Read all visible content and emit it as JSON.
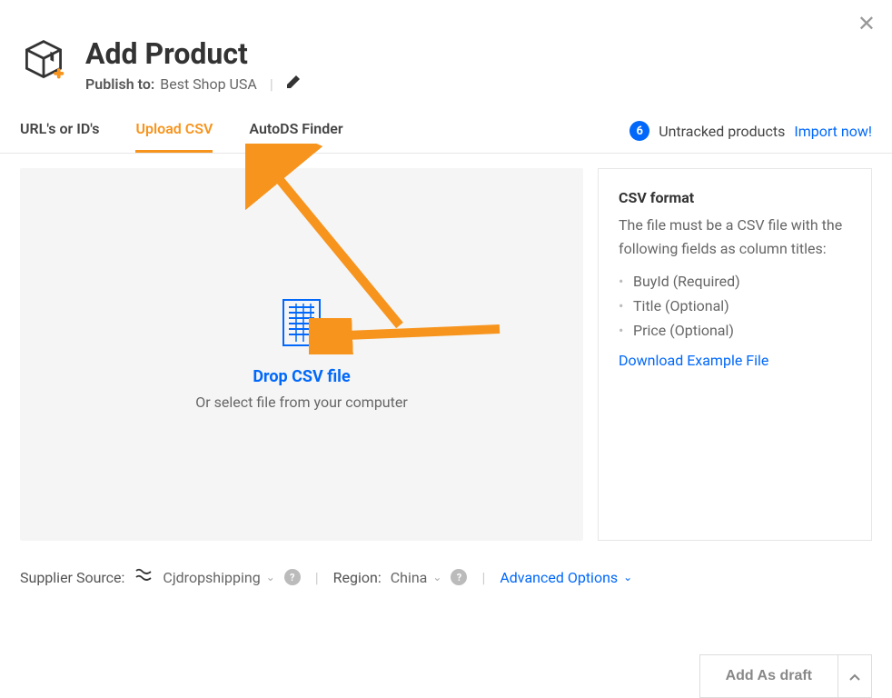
{
  "header": {
    "title": "Add Product",
    "publish_label": "Publish to:",
    "publish_value": "Best Shop USA"
  },
  "tabs": {
    "items": [
      {
        "id": "urls",
        "label": "URL's or ID's",
        "active": false
      },
      {
        "id": "upload",
        "label": "Upload CSV",
        "active": true
      },
      {
        "id": "finder",
        "label": "AutoDS Finder",
        "active": false
      }
    ],
    "untracked": {
      "count": "6",
      "label": "Untracked products",
      "action": "Import now!"
    }
  },
  "dropzone": {
    "title": "Drop CSV file",
    "subtitle": "Or select file from your computer"
  },
  "csv_panel": {
    "heading": "CSV format",
    "desc": "The file must be a CSV file with the following fields as column titles:",
    "fields": [
      "BuyId (Required)",
      "Title (Optional)",
      "Price (Optional)"
    ],
    "download": "Download Example File"
  },
  "bottom": {
    "supplier_label": "Supplier Source:",
    "supplier_value": "Cjdropshipping",
    "region_label": "Region:",
    "region_value": "China",
    "advanced": "Advanced Options"
  },
  "actions": {
    "draft": "Add As draft"
  }
}
